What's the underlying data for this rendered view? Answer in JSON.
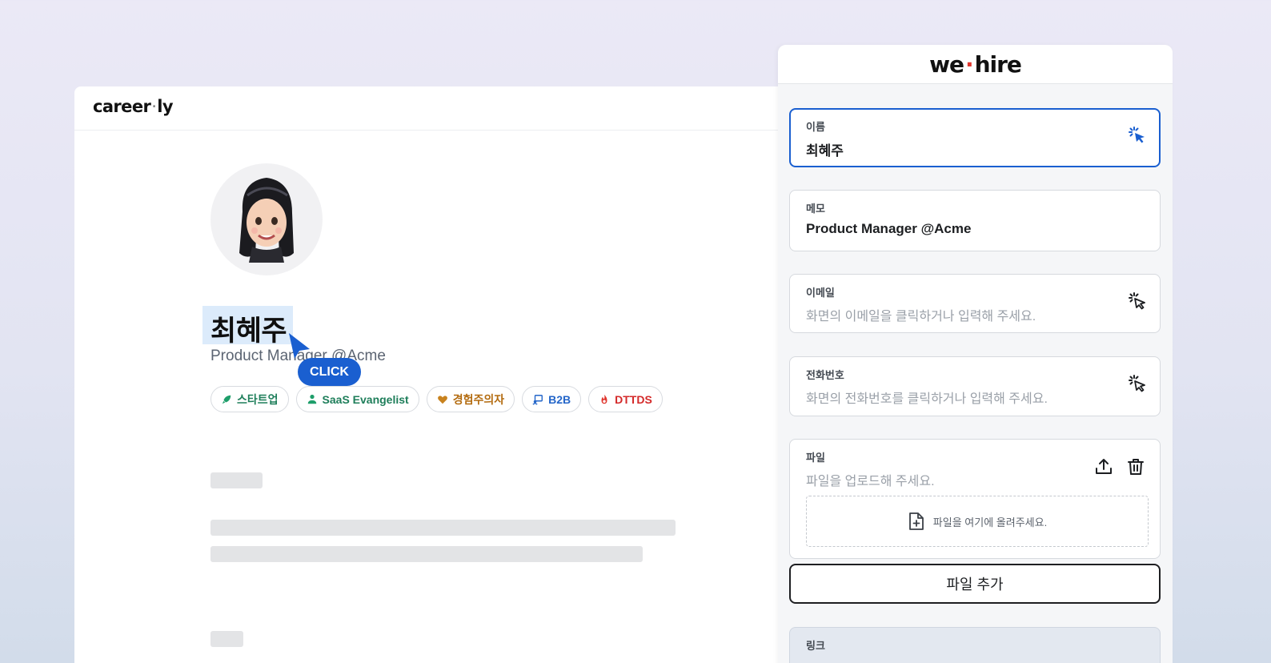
{
  "careerly": {
    "logo_left": "career",
    "logo_dot": "·",
    "logo_right": "ly",
    "profile": {
      "name": "최혜주",
      "subtitle": "Product Manager @Acme",
      "click_label": "CLICK",
      "tags": [
        {
          "label": "스타트업",
          "icon": "rocket-icon",
          "color": "#1e7e5a"
        },
        {
          "label": "SaaS Evangelist",
          "icon": "person-hand-icon",
          "color": "#1e7e5a"
        },
        {
          "label": "경험주의자",
          "icon": "heart-icon",
          "color": "#b36b0f"
        },
        {
          "label": "B2B",
          "icon": "handshake-icon",
          "color": "#2466c9"
        },
        {
          "label": "DTTDS",
          "icon": "fire-icon",
          "color": "#d42a2a"
        }
      ]
    }
  },
  "wehire": {
    "logo_left": "we",
    "logo_dot": "·",
    "logo_right": "hire",
    "accent_color": "#1a5fd0",
    "fields": {
      "name": {
        "label": "이름",
        "value": "최혜주"
      },
      "memo": {
        "label": "메모",
        "value": "Product Manager @Acme"
      },
      "email": {
        "label": "이메일",
        "placeholder": "화면의 이메일을 클릭하거나 입력해 주세요."
      },
      "phone": {
        "label": "전화번호",
        "placeholder": "화면의 전화번호를 클릭하거나 입력해 주세요."
      },
      "file": {
        "label": "파일",
        "placeholder": "파일을 업로드해 주세요.",
        "dropzone_text": "파일을 여기에 올려주세요."
      },
      "link": {
        "label": "링크"
      }
    },
    "add_file_label": "파일 추가"
  }
}
